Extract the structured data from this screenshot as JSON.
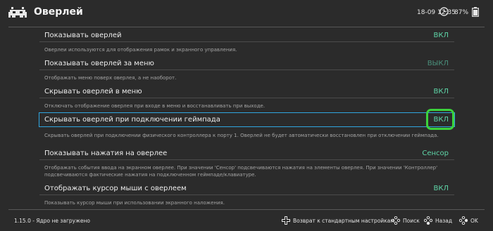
{
  "header": {
    "title": "Оверлей",
    "clock": "18-09 12:35",
    "battery": "87%"
  },
  "accent": "#5fd6a8",
  "selection_color": "#2fa6e0",
  "highlight_color": "#3cd33c",
  "settings": [
    {
      "label": "Показывать оверлей",
      "value": "ВКЛ",
      "description": "Оверлеи используются для отображения рамок и экранного управления."
    },
    {
      "label": "Показывать оверлей за меню",
      "value": "ВЫКЛ",
      "description": "Отображать меню поверх оверлея, а не наоборот."
    },
    {
      "label": "Скрывать оверлей в меню",
      "value": "ВКЛ",
      "description": "Отключать отображение оверлея при входе в меню и восстанавливать при выходе."
    },
    {
      "label": "Скрывать оверлей при подключении геймпада",
      "value": "ВКЛ",
      "description": "Скрывать оверлей при подключении физического контроллера к порту 1. Оверлей не будет автоматически восстановлен при отключении геймпада."
    },
    {
      "label": "Показывать нажатия на оверлее",
      "value": "Сенсор",
      "description": "Отображать события ввода на экранном оверлее. При значении 'Сенсор' подсвечиваются нажатия на элементы оверлея. При значении 'Контроллер' подсвечиваются фактические нажатия на подключенном геймпаде/клавиатуре."
    },
    {
      "label": "Отображать курсор мыши с оверлеем",
      "value": "ВКЛ",
      "description": "Показывать курсор мыши при использовании экранного наложения."
    }
  ],
  "footer": {
    "version": "1.15.0 - Ядро не загружено",
    "reset_label": "Возврат к стандартным настройкам",
    "search_label": "Поиск",
    "back_label": "Назад",
    "ok_label": "OK"
  }
}
